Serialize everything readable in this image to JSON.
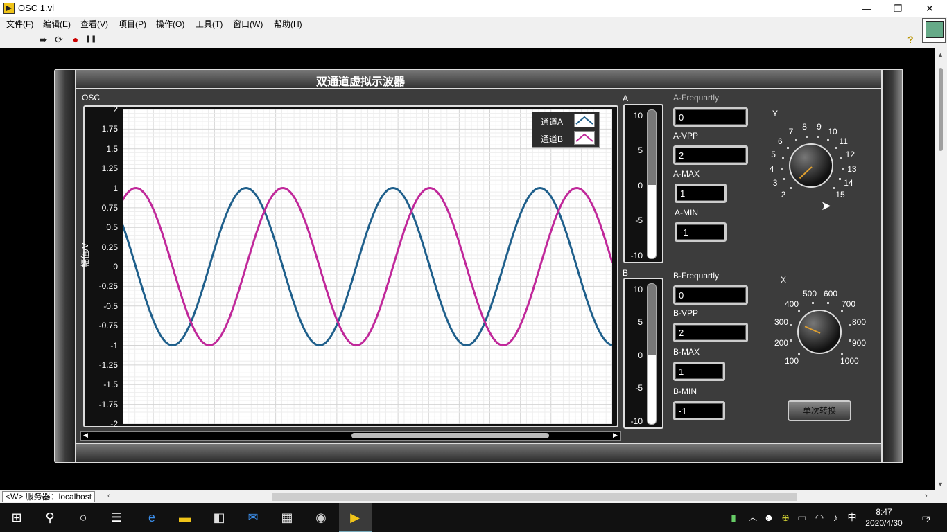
{
  "window": {
    "title": "OSC 1.vi",
    "minimize": "—",
    "maximize": "❐",
    "close": "✕"
  },
  "menu": [
    "文件(F)",
    "编辑(E)",
    "查看(V)",
    "项目(P)",
    "操作(O)",
    "工具(T)",
    "窗口(W)",
    "帮助(H)"
  ],
  "toolbar": {
    "run": "➨",
    "run_cont": "⟳",
    "abort": "●",
    "pause": "❚❚",
    "help": "?"
  },
  "panel": {
    "title": "双通道虚拟示波器"
  },
  "graph": {
    "label": "OSC",
    "ylabel": "幅值/V",
    "yticks": [
      "2",
      "1.75",
      "1.5",
      "1.25",
      "1",
      "0.75",
      "0.5",
      "0.25",
      "0",
      "-0.25",
      "-0.5",
      "-0.75",
      "-1",
      "-1.25",
      "-1.5",
      "-1.75",
      "-2"
    ],
    "legend": [
      "通道A",
      "通道B"
    ]
  },
  "chart_data": {
    "type": "line",
    "ylim": [
      -2,
      2
    ],
    "xlim": [
      0,
      1
    ],
    "series": [
      {
        "name": "通道A",
        "color": "#1f5f8b",
        "amplitude": 1,
        "cycles": 3.33,
        "phase_deg": 58
      },
      {
        "name": "通道B",
        "color": "#c0289a",
        "amplitude": 1,
        "cycles": 3.33,
        "phase_deg": -32
      }
    ]
  },
  "meterA": {
    "label": "A",
    "ticks": [
      "10",
      "5",
      "0",
      "-5",
      "-10"
    ],
    "value": 0
  },
  "meterB": {
    "label": "B",
    "ticks": [
      "10",
      "5",
      "0",
      "-5",
      "-10"
    ],
    "value": 0
  },
  "fields": {
    "a_freq": {
      "label": "A-Frequartly",
      "value": "0"
    },
    "a_vpp": {
      "label": "A-VPP",
      "value": "2"
    },
    "a_max": {
      "label": "A-MAX",
      "value": "1"
    },
    "a_min": {
      "label": "A-MIN",
      "value": "-1"
    },
    "b_freq": {
      "label": "B-Frequartly",
      "value": "0"
    },
    "b_vpp": {
      "label": "B-VPP",
      "value": "2"
    },
    "b_max": {
      "label": "B-MAX",
      "value": "1"
    },
    "b_min": {
      "label": "B-MIN",
      "value": "-1"
    }
  },
  "knobY": {
    "label": "Y",
    "ticks": [
      "2",
      "3",
      "4",
      "5",
      "6",
      "7",
      "8",
      "9",
      "10",
      "11",
      "12",
      "13",
      "14",
      "15"
    ],
    "value": 2
  },
  "knobX": {
    "label": "X",
    "ticks": [
      "100",
      "200",
      "300",
      "400",
      "500",
      "600",
      "700",
      "800",
      "900",
      "1000"
    ],
    "value": 300
  },
  "button_single": "单次转换",
  "status": {
    "server": "<W> 服务器：localhost"
  },
  "taskbar": {
    "time": "8:47",
    "date": "2020/4/30",
    "ime": "中",
    "notif_count": "2"
  }
}
